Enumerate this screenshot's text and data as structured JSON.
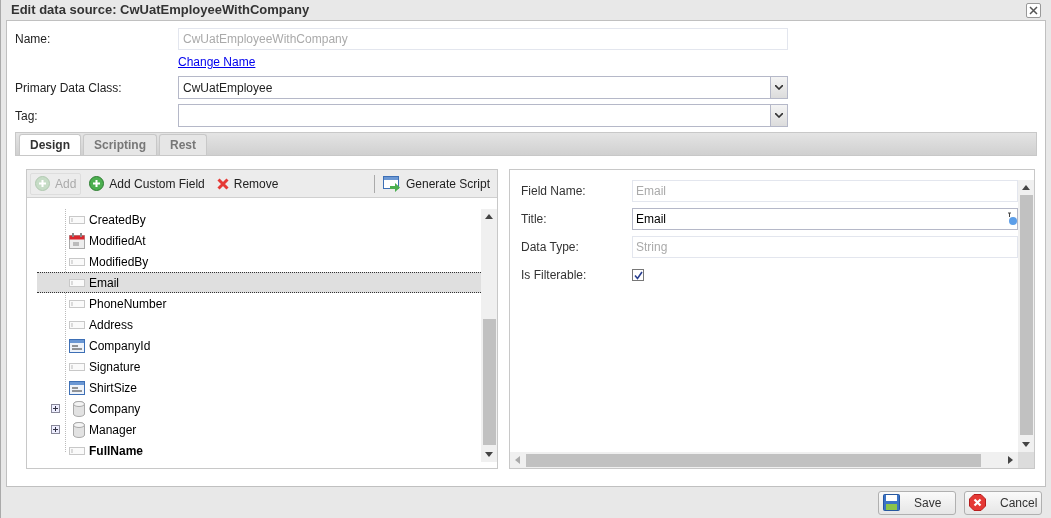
{
  "window": {
    "title": "Edit data source: CwUatEmployeeWithCompany"
  },
  "form": {
    "name": {
      "label": "Name:",
      "value": "CwUatEmployeeWithCompany",
      "disabled": true
    },
    "change_name_link": "Change Name",
    "primary_data_class": {
      "label": "Primary Data Class:",
      "value": "CwUatEmployee"
    },
    "tag": {
      "label": "Tag:"
    }
  },
  "tabs": [
    {
      "label": "Design",
      "selected": true
    },
    {
      "label": "Scripting",
      "selected": false
    },
    {
      "label": "Rest",
      "selected": false
    }
  ],
  "toolbar": [
    {
      "label": "Add",
      "kind": "add",
      "disabled": true
    },
    {
      "label": "Add Custom Field",
      "kind": "add",
      "disabled": false
    },
    {
      "label": "Remove",
      "kind": "remove",
      "disabled": false
    },
    {
      "label": "Generate Script",
      "kind": "script",
      "disabled": false
    }
  ],
  "tree": [
    {
      "label": "CreatedBy",
      "kind": "field",
      "selected": false,
      "bold": false
    },
    {
      "label": "ModifiedAt",
      "kind": "date",
      "selected": false,
      "bold": false
    },
    {
      "label": "ModifiedBy",
      "kind": "field",
      "selected": false,
      "bold": false
    },
    {
      "label": "Email",
      "kind": "field",
      "selected": true,
      "bold": false
    },
    {
      "label": "PhoneNumber",
      "kind": "field",
      "selected": false,
      "bold": false
    },
    {
      "label": "Address",
      "kind": "field",
      "selected": false,
      "bold": false
    },
    {
      "label": "CompanyId",
      "kind": "enum",
      "selected": false,
      "bold": false
    },
    {
      "label": "Signature",
      "kind": "field",
      "selected": false,
      "bold": false
    },
    {
      "label": "ShirtSize",
      "kind": "enum",
      "selected": false,
      "bold": false
    },
    {
      "label": "Company",
      "kind": "relation",
      "selected": false,
      "bold": false,
      "expanded": false
    },
    {
      "label": "Manager",
      "kind": "relation",
      "selected": false,
      "bold": false,
      "expanded": false
    },
    {
      "label": "FullName",
      "kind": "field",
      "selected": false,
      "bold": true
    }
  ],
  "properties": {
    "field_name": {
      "label": "Field Name:",
      "value": "Email",
      "disabled": true
    },
    "title": {
      "label": "Title:",
      "value": "Email"
    },
    "data_type": {
      "label": "Data Type:",
      "value": "String",
      "disabled": true
    },
    "is_filterable": {
      "label": "Is Filterable:",
      "checked": true
    }
  },
  "buttons": [
    {
      "label": "Save",
      "kind": "save"
    },
    {
      "label": "Cancel",
      "kind": "cancel"
    }
  ]
}
